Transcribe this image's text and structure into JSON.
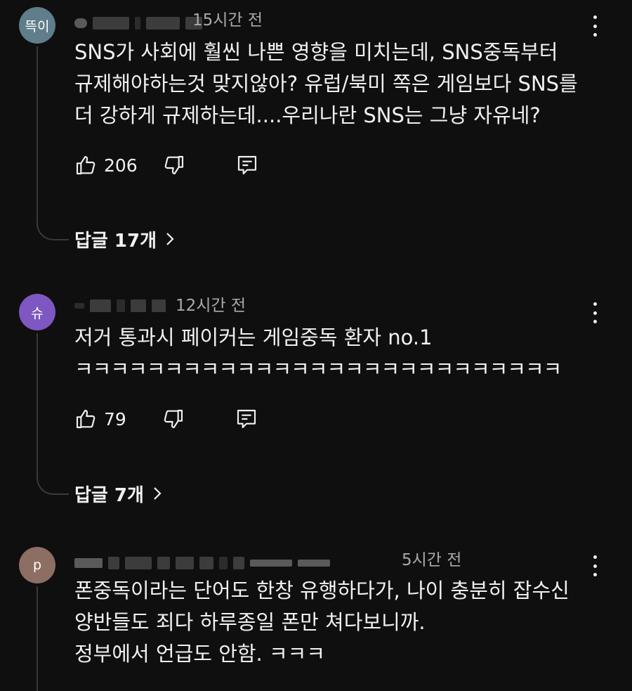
{
  "comments": [
    {
      "avatar_text": "뜩이",
      "avatar_color": "#607d8b",
      "timestamp": "15시간 전",
      "lines": [
        "SNS가 사회에 훨씬 나쁜 영향을 미치는데, SNS중독부터",
        "규제해야하는것 맞지않아? 유럽/북미 쪽은 게임보다 SNS를",
        "더 강하게 규제하는데....우리나란 SNS는 그냥 자유네?"
      ],
      "likes": "206",
      "replies_label": "답글 17개"
    },
    {
      "avatar_text": "슈",
      "avatar_color": "#7e57c2",
      "timestamp": "12시간 전",
      "lines": [
        "저거 통과시 페이커는 게임중독 환자 no.1",
        "ㅋㅋㅋㅋㅋㅋㅋㅋㅋㅋㅋㅋㅋㅋㅋㅋㅋㅋㅋㅋㅋㅋㅋㅋㅋㅋㅋ"
      ],
      "likes": "79",
      "replies_label": "답글 7개"
    },
    {
      "avatar_text": "p",
      "avatar_color": "#8d6e63",
      "timestamp": "5시간 전",
      "lines": [
        "폰중독이라는 단어도 한창 유행하다가, 나이 충분히 잡수신",
        "양반들도 죄다 하루종일 폰만 쳐다보니까.",
        "정부에서 언급도 안함. ㅋㅋㅋ"
      ]
    }
  ],
  "icons": {
    "like": "thumbs-up-icon",
    "dislike": "thumbs-down-icon",
    "reply": "comment-reply-icon",
    "menu": "more-vertical-icon",
    "chevron": "chevron-right-icon"
  }
}
